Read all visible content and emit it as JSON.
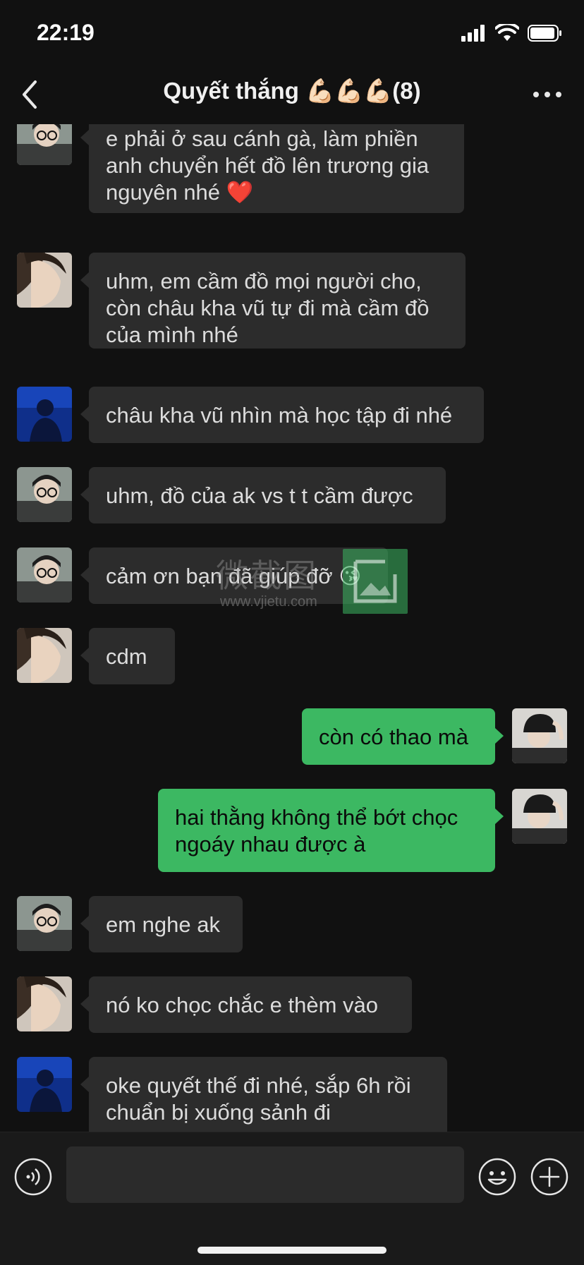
{
  "status": {
    "time": "22:19"
  },
  "header": {
    "title": "Quyết thắng 💪🏻💪🏻💪🏻(8)"
  },
  "messages": [
    {
      "text": "e phải ở sau cánh gà, làm phiền anh chuyển hết đồ lên trương gia nguyên nhé ❤️",
      "side": "in",
      "avatar": "avatar-glasses"
    },
    {
      "text": "uhm, em cầm đồ mọi người cho, còn châu kha vũ tự đi mà cầm đồ của mình nhé",
      "side": "in",
      "avatar": "avatar-profile"
    },
    {
      "text": "châu kha vũ nhìn mà học tập đi nhé",
      "side": "in",
      "avatar": "avatar-blue"
    },
    {
      "text": "uhm, đồ của ak vs t t cầm được",
      "side": "in",
      "avatar": "avatar-glasses"
    },
    {
      "text": "cảm ơn bạn đã giúp đỡ 😘",
      "side": "in",
      "avatar": "avatar-glasses"
    },
    {
      "text": "cdm",
      "side": "in",
      "avatar": "avatar-profile"
    },
    {
      "text": "còn có thao mà",
      "side": "out",
      "avatar": "avatar-beanie"
    },
    {
      "text": "hai thằng không thể bớt chọc ngoáy nhau được à",
      "side": "out",
      "avatar": "avatar-beanie"
    },
    {
      "text": "em nghe ak",
      "side": "in",
      "avatar": "avatar-glasses"
    },
    {
      "text": "nó ko chọc chắc e thèm vào",
      "side": "in",
      "avatar": "avatar-profile"
    },
    {
      "text": "oke quyết thế đi nhé, sắp 6h rồi chuẩn bị xuống sảnh đi",
      "side": "in",
      "avatar": "avatar-blue"
    }
  ],
  "watermark": {
    "text": "微截图",
    "url": "www.vjietu.com"
  },
  "input": {
    "value": ""
  },
  "colors": {
    "background": "#111111",
    "incoming_bubble": "#2c2c2c",
    "outgoing_bubble": "#3cb862"
  }
}
